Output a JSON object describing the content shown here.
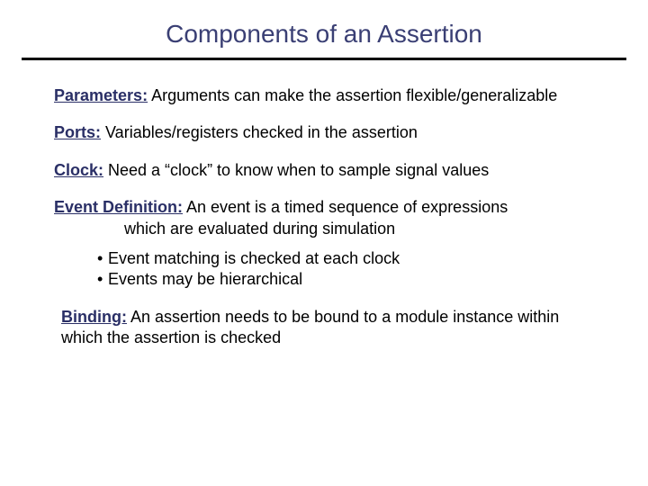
{
  "title": "Components of an Assertion",
  "items": {
    "parameters": {
      "label": "Parameters:",
      "desc": " Arguments can make the assertion flexible/generalizable"
    },
    "ports": {
      "label": "Ports:",
      "desc": " Variables/registers checked in the assertion"
    },
    "clock": {
      "label": "Clock:",
      "desc": " Need a “clock” to know when to sample signal values"
    },
    "event": {
      "label": "Event Definition:",
      "desc": " An event is a timed sequence of expressions",
      "cont": "which are evaluated during simulation"
    },
    "sub": {
      "a": "Event matching is checked at each clock",
      "b": "Events may be hierarchical"
    },
    "binding": {
      "label": "Binding:",
      "desc": " An assertion needs to be bound to a module instance within which the assertion is checked"
    }
  },
  "bullet": "• "
}
